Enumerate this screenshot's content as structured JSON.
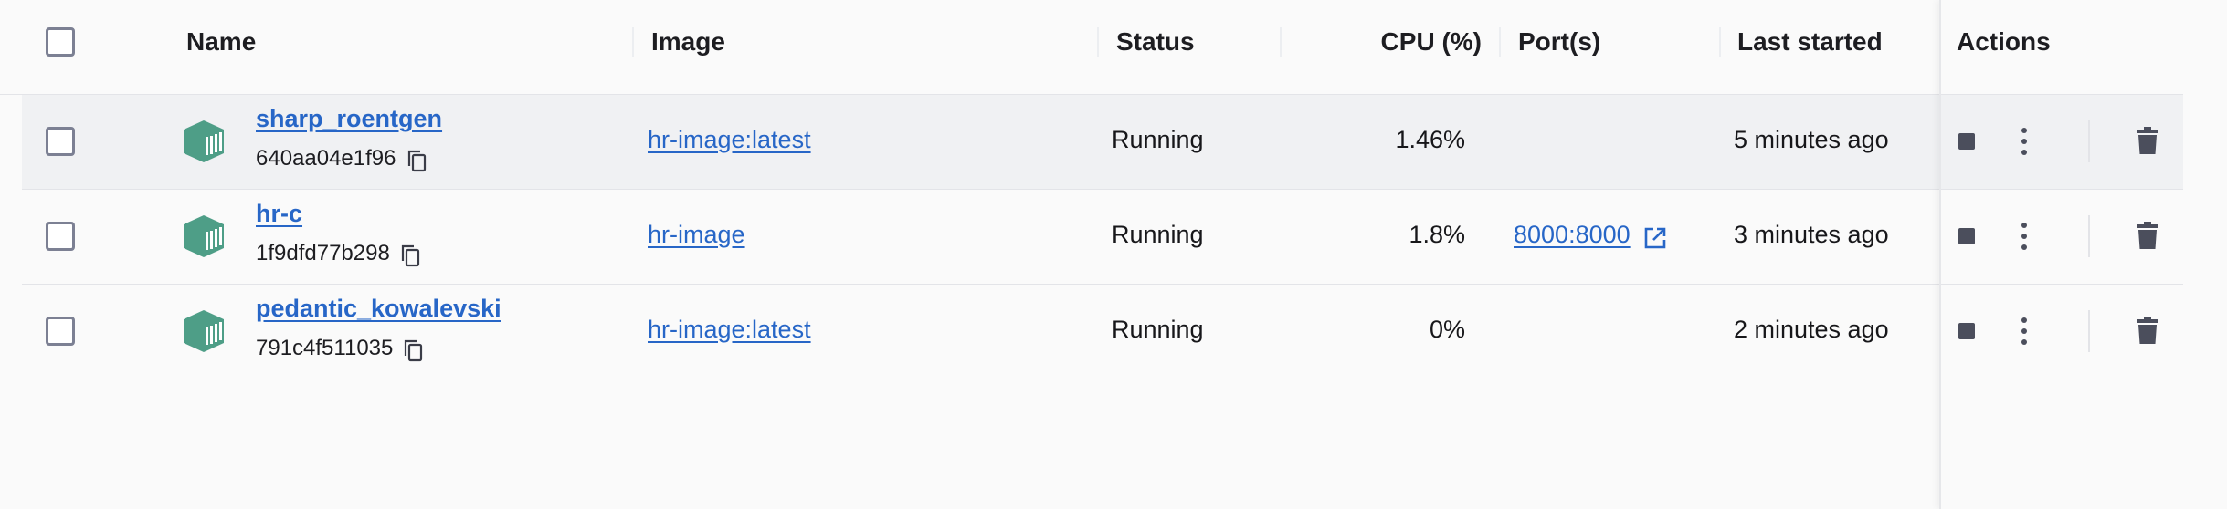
{
  "header": {
    "name": "Name",
    "image": "Image",
    "status": "Status",
    "cpu": "CPU (%)",
    "ports": "Port(s)",
    "last_started": "Last started",
    "actions": "Actions"
  },
  "colors": {
    "link": "#2766c7",
    "container_icon": "#4e9e87",
    "row_highlight": "#f0f1f3",
    "action_icon": "#4b4e5c"
  },
  "rows": [
    {
      "name": "sharp_roentgen",
      "id": "640aa04e1f96",
      "image": "hr-image:latest",
      "status": "Running",
      "cpu": "1.46%",
      "port": "",
      "last_started": "5 minutes ago",
      "highlighted": true
    },
    {
      "name": "hr-c",
      "id": "1f9dfd77b298",
      "image": "hr-image",
      "status": "Running",
      "cpu": "1.8%",
      "port": "8000:8000",
      "last_started": "3 minutes ago",
      "highlighted": false
    },
    {
      "name": "pedantic_kowalevski",
      "id": "791c4f511035",
      "image": "hr-image:latest",
      "status": "Running",
      "cpu": "0%",
      "port": "",
      "last_started": "2 minutes ago",
      "highlighted": false
    }
  ],
  "icons": {
    "container": "container-icon",
    "copy": "copy-icon",
    "external": "external-link-icon",
    "stop": "stop-icon",
    "more": "more-vertical-icon",
    "delete": "trash-icon"
  }
}
